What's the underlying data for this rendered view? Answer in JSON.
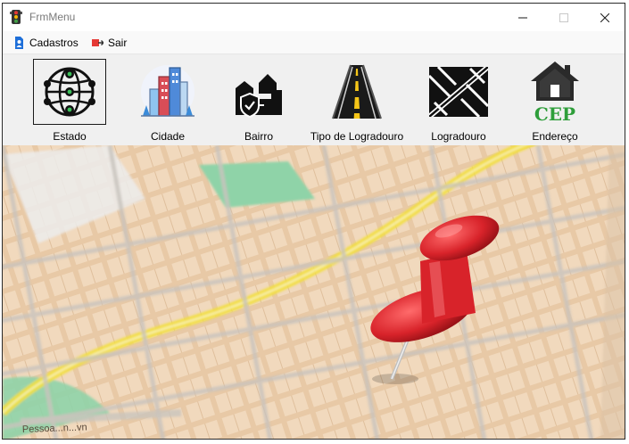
{
  "window": {
    "title": "FrmMenu"
  },
  "menu": {
    "cadastros": "Cadastros",
    "sair": "Sair"
  },
  "toolbar": {
    "items": [
      {
        "label": "Estado",
        "icon": "globe-network-icon"
      },
      {
        "label": "Cidade",
        "icon": "city-buildings-icon"
      },
      {
        "label": "Bairro",
        "icon": "neighborhood-shield-icon"
      },
      {
        "label": "Tipo de Logradouro",
        "icon": "road-icon"
      },
      {
        "label": "Logradouro",
        "icon": "street-grid-icon"
      },
      {
        "label": "Endereço",
        "icon": "house-cep-icon"
      }
    ]
  },
  "cep_badge": "CEP",
  "map": {
    "street_label": "Pessoa...n...vn"
  },
  "colors": {
    "cep_green": "#2e9e3a",
    "pin_red": "#d8232a",
    "road_yellow": "#f2df3a",
    "park_green": "#8fd3a8"
  }
}
